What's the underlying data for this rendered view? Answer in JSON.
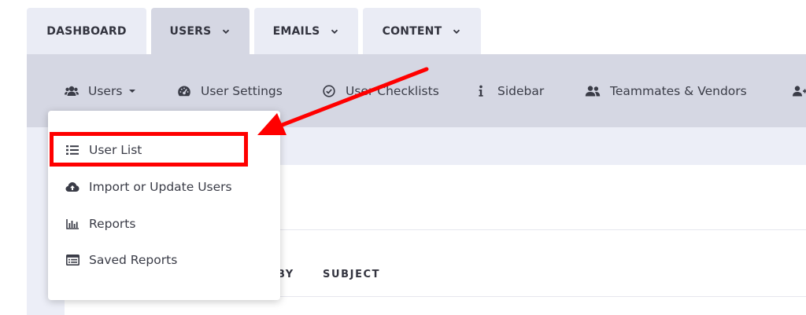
{
  "tabs": [
    {
      "label": "DASHBOARD",
      "has_chevron": false
    },
    {
      "label": "USERS",
      "has_chevron": true,
      "active": true
    },
    {
      "label": "EMAILS",
      "has_chevron": true
    },
    {
      "label": "CONTENT",
      "has_chevron": true
    }
  ],
  "subnav": {
    "items": [
      {
        "label": "Users",
        "icon": "users-icon",
        "has_caret": true
      },
      {
        "label": "User Settings",
        "icon": "gauge-icon"
      },
      {
        "label": "User Checklists",
        "icon": "check-circle-icon"
      },
      {
        "label": "Sidebar",
        "icon": "info-icon"
      },
      {
        "label": "Teammates & Vendors",
        "icon": "user-group-icon"
      }
    ]
  },
  "dropdown": {
    "items": [
      {
        "label": "User List",
        "icon": "list-icon"
      },
      {
        "label": "Import or Update Users",
        "icon": "cloud-upload-icon"
      },
      {
        "label": "Reports",
        "icon": "bar-chart-icon"
      },
      {
        "label": "Saved Reports",
        "icon": "saved-list-icon"
      }
    ]
  },
  "table": {
    "headers": [
      "BY",
      "SUBJECT"
    ]
  },
  "colors": {
    "annotation": "#ff0000",
    "active_tab": "#d5d7e3",
    "tab": "#eaecf5"
  }
}
